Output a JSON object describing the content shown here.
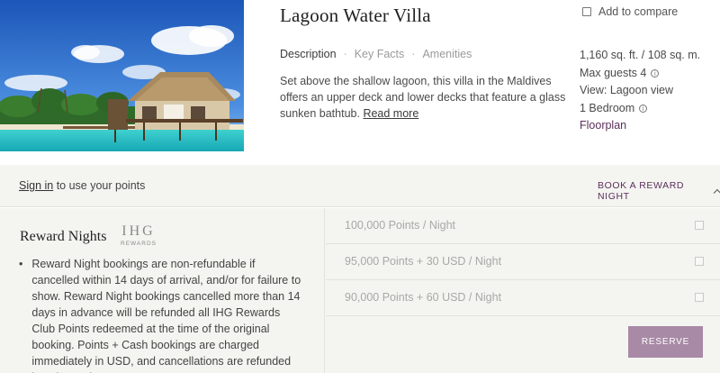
{
  "room": {
    "title": "Lagoon Water Villa",
    "tabs": [
      {
        "label": "Description",
        "active": true
      },
      {
        "label": "Key Facts",
        "active": false
      },
      {
        "label": "Amenities",
        "active": false
      }
    ],
    "tab_separator": "·",
    "description": "Set above the shallow lagoon, this villa in the Maldives offers an upper deck and lower decks that feature a glass sunken bathtub.",
    "read_more": "Read more",
    "compare_label": "Add to compare",
    "compare_checked": false,
    "facts": {
      "size": "1,160 sq. ft. / 108 sq. m.",
      "max_guests": "Max guests 4",
      "view": "View: Lagoon view",
      "bedrooms": "1 Bedroom",
      "floorplan": "Floorplan"
    },
    "photo_icon": "water-villa-photo"
  },
  "signin": {
    "link": "Sign in",
    "suffix": " to use your points",
    "book_reward": "BOOK A REWARD NIGHT",
    "book_reward_icon": "chevron-up-icon"
  },
  "rewards": {
    "title": "Reward Nights",
    "brand_big": "IHG",
    "brand_small": "REWARDS",
    "bullet": "•",
    "policy": "Reward Night bookings are non-refundable if cancelled within 14 days of arrival, and/or for failure to show. Reward Night bookings cancelled more than 14 days in advance will be refunded all IHG Rewards Club Points redeemed at the time of the original booking. Points + Cash bookings are charged immediately in USD, and cancellations are refunded in points only",
    "options": [
      {
        "label": "100,000 Points / Night",
        "checked": false
      },
      {
        "label": "95,000 Points + 30 USD / Night",
        "checked": false
      },
      {
        "label": "90,000 Points + 60 USD / Night",
        "checked": false
      }
    ],
    "reserve": "RESERVE"
  },
  "colors": {
    "accent": "#5b2f5c",
    "reserve_bg": "#a889a6",
    "panel_bg": "#f4f4f0"
  }
}
